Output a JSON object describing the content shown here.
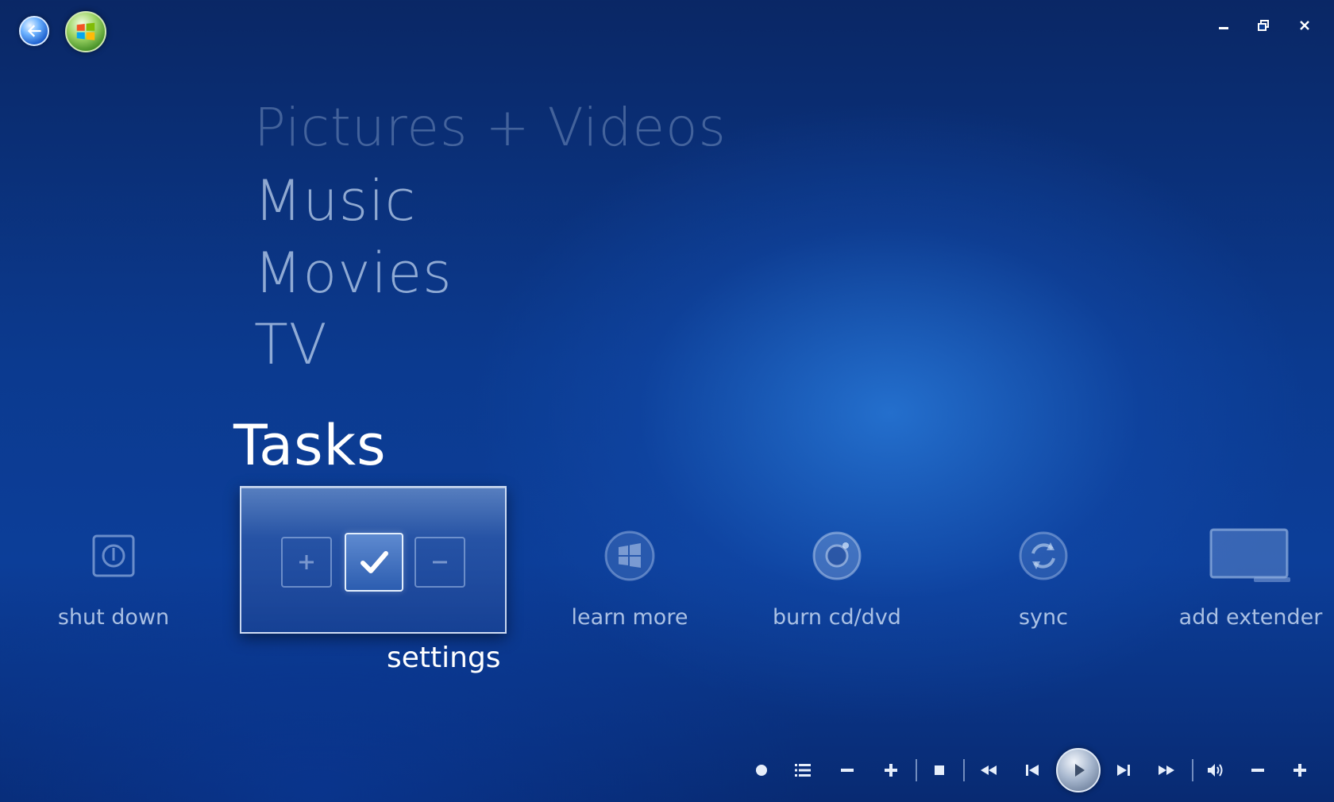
{
  "menu": {
    "pictures": "Pictures + Videos",
    "music": "Music",
    "movies": "Movies",
    "tv": "TV",
    "tasks": "Tasks"
  },
  "tasks": {
    "shutdown": "shut down",
    "settings": "settings",
    "learn": "learn more",
    "burn": "burn cd/dvd",
    "sync": "sync",
    "extender": "add extender"
  },
  "icons": {
    "back": "back-arrow-icon",
    "start": "windows-orb-icon",
    "minimize": "minimize-icon",
    "restore": "restore-icon",
    "close": "close-icon",
    "record": "record-icon",
    "guide": "list-icon",
    "channel_down": "minus-icon",
    "channel_up": "plus-icon",
    "stop": "stop-icon",
    "rewind": "rewind-icon",
    "previous": "skip-previous-icon",
    "play": "play-icon",
    "next": "skip-next-icon",
    "fast_forward": "fast-forward-icon",
    "volume": "volume-icon",
    "volume_down": "minus-icon",
    "volume_up": "plus-icon"
  },
  "colors": {
    "background": "#0b3a8f",
    "menu_text": "#c8dcf5",
    "selected": "#ffffff"
  }
}
